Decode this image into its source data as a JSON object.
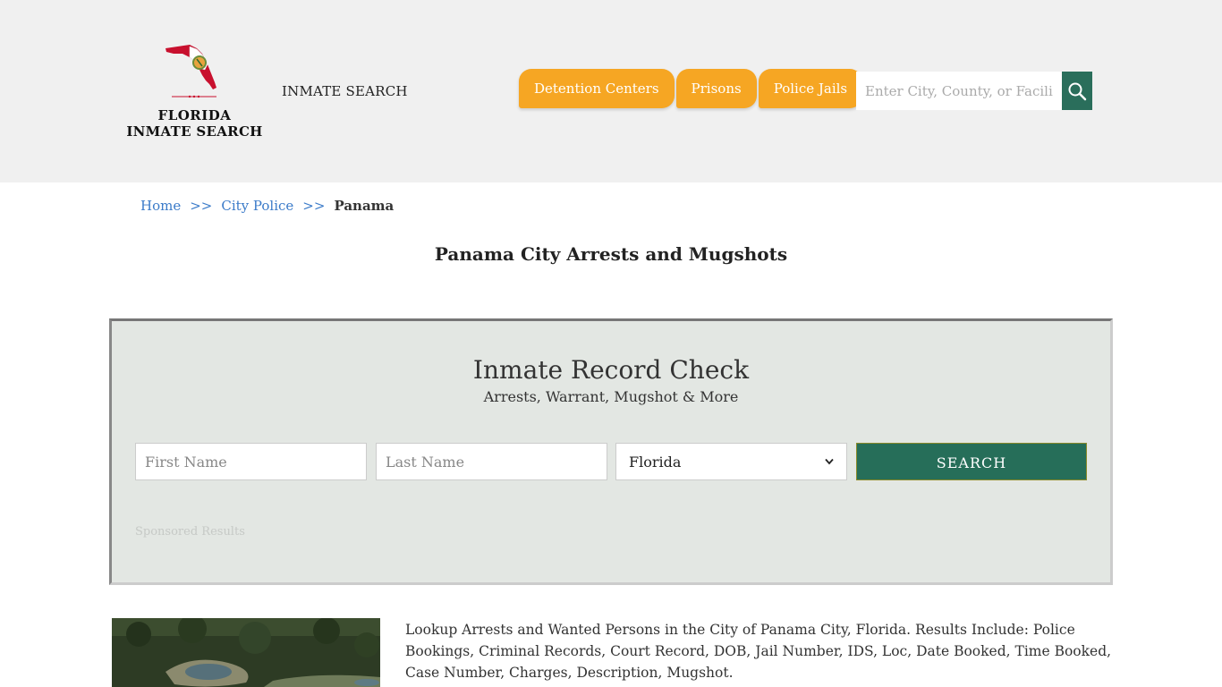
{
  "header": {
    "logo_line1": "FLORIDA",
    "logo_line2": "INMATE SEARCH",
    "site_link": "INMATE SEARCH",
    "nav": [
      "Detention Centers",
      "Prisons",
      "Police Jails"
    ],
    "search_placeholder": "Enter City, County, or Facility"
  },
  "breadcrumb": {
    "home": "Home",
    "separator": ">>",
    "city_police": "City Police",
    "current": "Panama"
  },
  "page_title": "Panama City Arrests and Mugshots",
  "record_check": {
    "title": "Inmate Record Check",
    "subtitle": "Arrests, Warrant, Mugshot & More",
    "first_name_placeholder": "First Name",
    "last_name_placeholder": "Last Name",
    "state_value": "Florida",
    "search_label": "SEARCH",
    "sponsored": "Sponsored Results"
  },
  "content": {
    "description": "Lookup Arrests and Wanted Persons in the City of Panama City, Florida. Results Include: Police Bookings, Criminal Records, Court Record, DOB, Jail Number, IDS, Loc, Date Booked, Time Booked, Case Number, Charges, Description, Mugshot."
  },
  "colors": {
    "header_bg": "#f0f0f0",
    "nav_orange": "#f6a623",
    "brand_green": "#266e59",
    "link_blue": "#3b7bc9",
    "panel_bg": "#e3e7e3"
  }
}
